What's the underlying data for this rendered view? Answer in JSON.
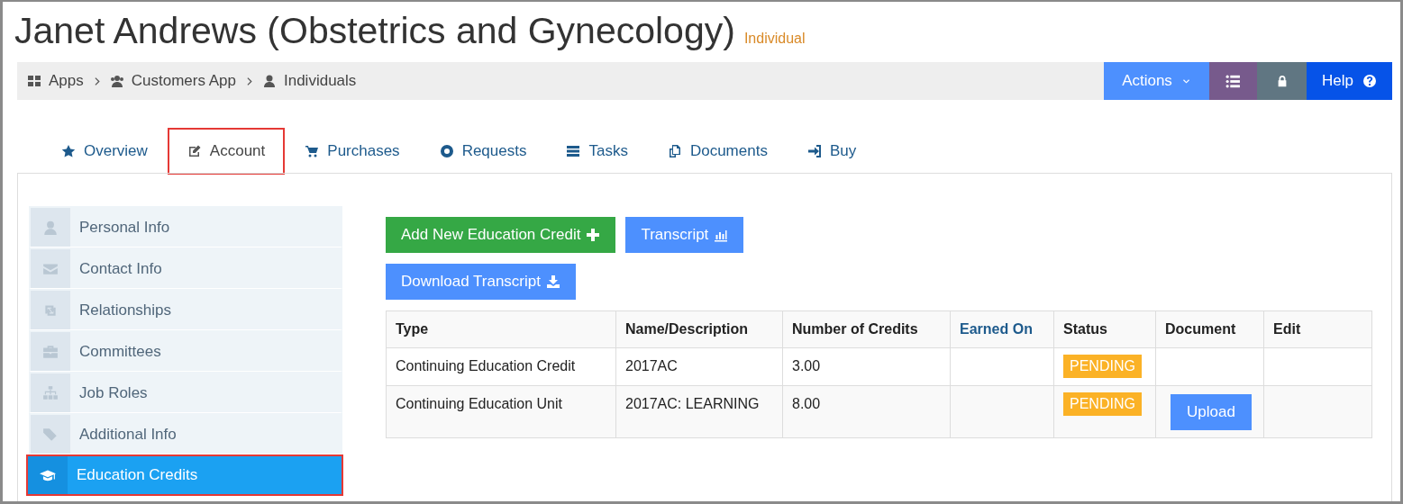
{
  "header": {
    "title": "Janet Andrews (Obstetrics and Gynecology)",
    "subtitle": "Individual"
  },
  "breadcrumbs": [
    {
      "label": "Apps"
    },
    {
      "label": "Customers App"
    },
    {
      "label": "Individuals"
    }
  ],
  "toolbar": {
    "actions": "Actions",
    "help": "Help"
  },
  "tabs": [
    {
      "label": "Overview",
      "highlighted": false
    },
    {
      "label": "Account",
      "highlighted": true
    },
    {
      "label": "Purchases",
      "highlighted": false
    },
    {
      "label": "Requests",
      "highlighted": false
    },
    {
      "label": "Tasks",
      "highlighted": false
    },
    {
      "label": "Documents",
      "highlighted": false
    },
    {
      "label": "Buy",
      "highlighted": false
    }
  ],
  "sidebar": {
    "items": [
      {
        "label": "Personal Info",
        "selected": false,
        "highlighted": false
      },
      {
        "label": "Contact Info",
        "selected": false,
        "highlighted": false
      },
      {
        "label": "Relationships",
        "selected": false,
        "highlighted": false
      },
      {
        "label": "Committees",
        "selected": false,
        "highlighted": false
      },
      {
        "label": "Job Roles",
        "selected": false,
        "highlighted": false
      },
      {
        "label": "Additional Info",
        "selected": false,
        "highlighted": false
      },
      {
        "label": "Education Credits",
        "selected": true,
        "highlighted": true
      }
    ]
  },
  "buttons": [
    {
      "label": "Add New Education Credit",
      "kind": "add"
    },
    {
      "label": "Transcript",
      "kind": "chart"
    },
    {
      "label": "Download Transcript",
      "kind": "download"
    }
  ],
  "table": {
    "columns": [
      {
        "label": "Type",
        "sortable": false
      },
      {
        "label": "Name/Description",
        "sortable": false
      },
      {
        "label": "Number of Credits",
        "sortable": false
      },
      {
        "label": "Earned On",
        "sortable": true
      },
      {
        "label": "Status",
        "sortable": false
      },
      {
        "label": "Document",
        "sortable": false
      },
      {
        "label": "Edit",
        "sortable": false
      }
    ],
    "rows": [
      {
        "type": "Continuing Education Credit",
        "name": "2017AC",
        "credits": "3.00",
        "status": "PENDING"
      },
      {
        "type": "Continuing Education Unit",
        "name": "2017AC: LEARNING",
        "credits": "8.00",
        "status": "PENDING",
        "document": {
          "button": "Upload"
        }
      }
    ]
  }
}
